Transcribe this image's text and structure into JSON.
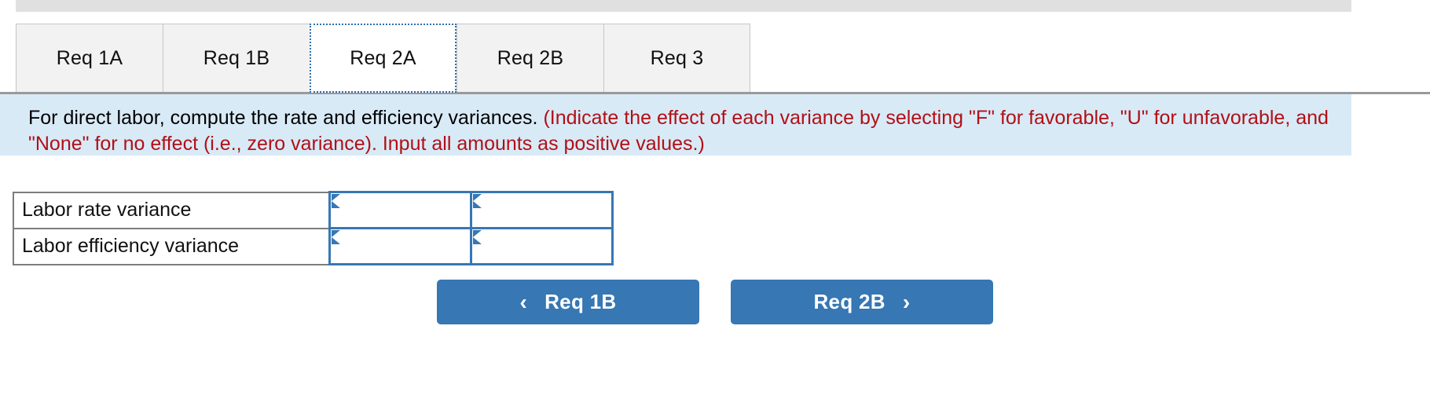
{
  "tabs": [
    {
      "label": "Req 1A",
      "active": false
    },
    {
      "label": "Req 1B",
      "active": false
    },
    {
      "label": "Req 2A",
      "active": true
    },
    {
      "label": "Req 2B",
      "active": false
    },
    {
      "label": "Req 3",
      "active": false
    }
  ],
  "instruction": {
    "prompt": "For direct labor, compute the rate and efficiency variances.",
    "hint": "(Indicate the effect of each variance by selecting \"F\" for favorable, \"U\" for unfavorable, and \"None\" for no effect (i.e., zero variance). Input all amounts as positive values.)",
    "background_color": "#d9eaf7",
    "hint_color": "#b11016"
  },
  "table": {
    "rows": [
      {
        "label": "Labor rate variance",
        "amount_value": "",
        "amount_placeholder": "",
        "effect_value": "",
        "effect_placeholder": ""
      },
      {
        "label": "Labor efficiency variance",
        "amount_value": "",
        "amount_placeholder": "",
        "effect_value": "",
        "effect_placeholder": ""
      }
    ]
  },
  "navigation": {
    "prev": {
      "label": "Req 1B",
      "icon": "chevron-left-icon",
      "glyph": "‹"
    },
    "next": {
      "label": "Req 2B",
      "icon": "chevron-right-icon",
      "glyph": "›"
    },
    "button_color": "#3677b4"
  }
}
